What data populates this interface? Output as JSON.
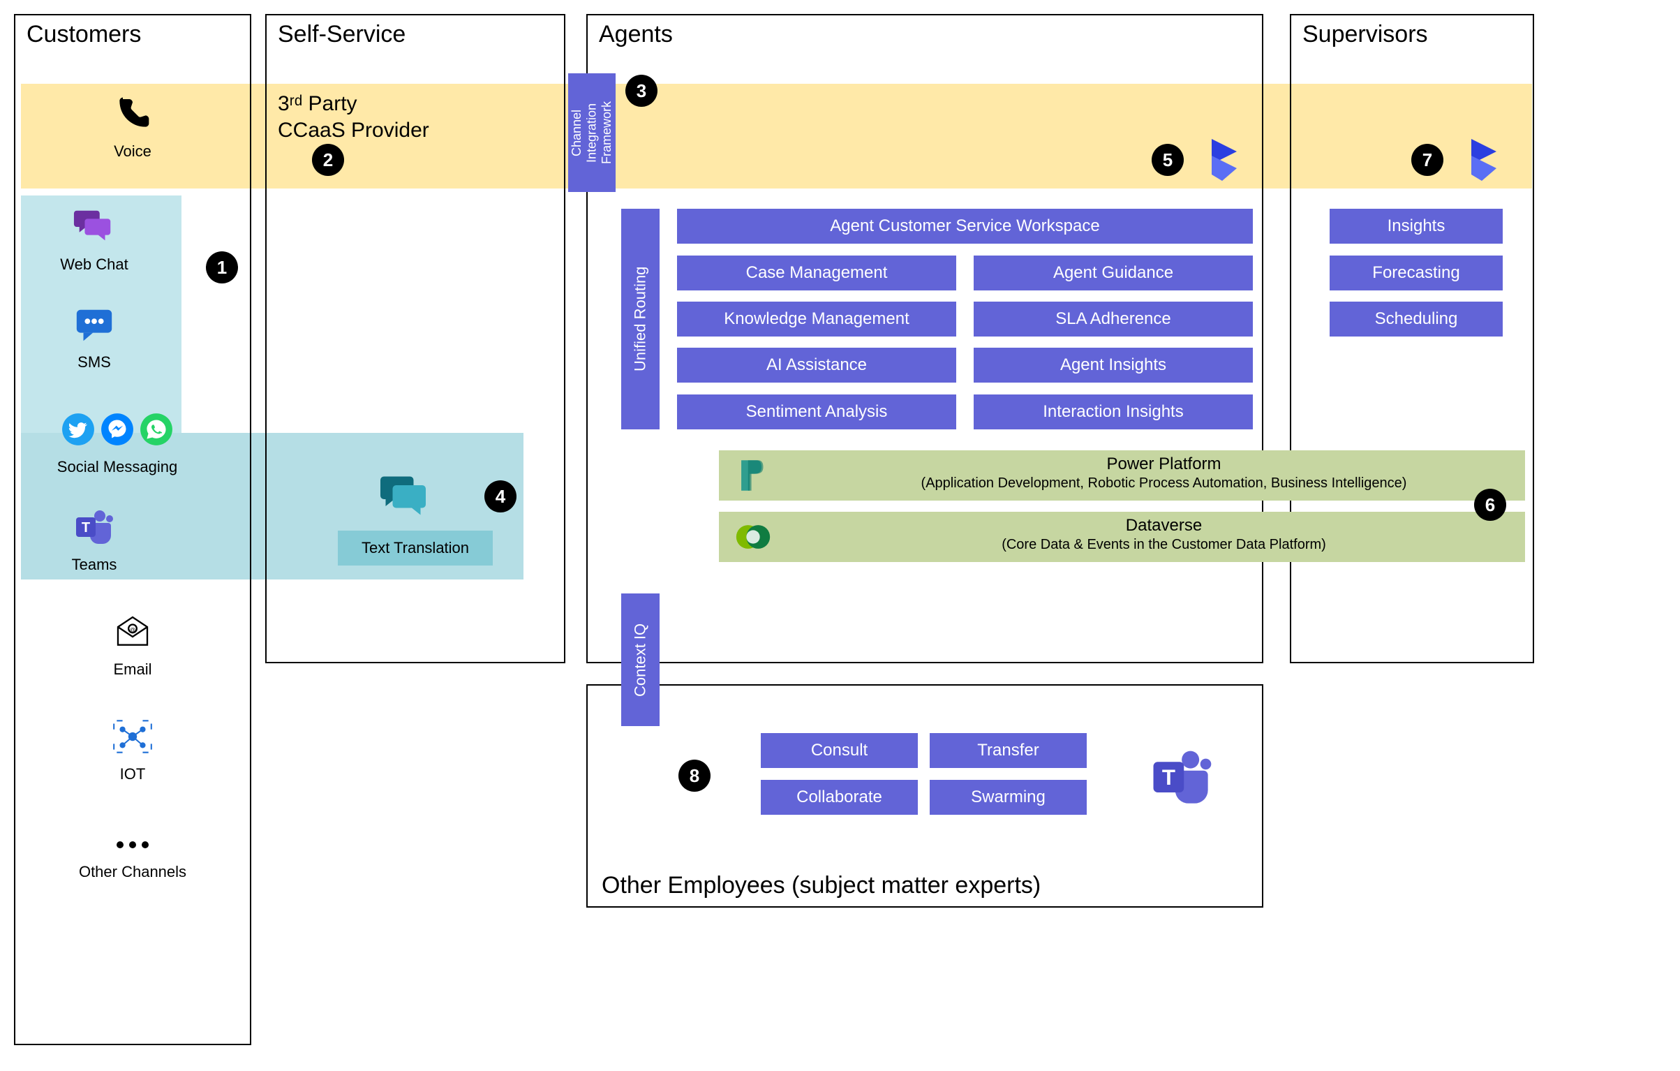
{
  "sections": {
    "customers": "Customers",
    "selfservice": "Self-Service",
    "agents": "Agents",
    "supervisors": "Supervisors",
    "other_employees": "Other Employees (subject matter experts)"
  },
  "ccaas": {
    "line1": "3ʳᵈ Party",
    "line2": "CCaaS Provider"
  },
  "cif": "Channel\nIntegration\nFramework",
  "unified_routing": "Unified Routing",
  "context_iq": "Context IQ",
  "agent_blocks": {
    "acsw": "Agent Customer Service Workspace",
    "case_mgmt": "Case Management",
    "agent_guidance": "Agent Guidance",
    "knowledge_mgmt": "Knowledge Management",
    "sla": "SLA Adherence",
    "ai_assist": "AI Assistance",
    "agent_insights": "Agent Insights",
    "sentiment": "Sentiment Analysis",
    "interaction_insights": "Interaction Insights"
  },
  "supervisor_blocks": {
    "insights": "Insights",
    "forecasting": "Forecasting",
    "scheduling": "Scheduling"
  },
  "other_emp_blocks": {
    "consult": "Consult",
    "transfer": "Transfer",
    "collaborate": "Collaborate",
    "swarming": "Swarming"
  },
  "platforms": {
    "pp_title": "Power Platform",
    "pp_sub": "(Application Development, Robotic Process Automation, Business Intelligence)",
    "dv_title": "Dataverse",
    "dv_sub": "(Core Data & Events in the Customer Data Platform)"
  },
  "text_translation": "Text Translation",
  "channels": {
    "voice": "Voice",
    "webchat": "Web Chat",
    "sms": "SMS",
    "social": "Social Messaging",
    "teams": "Teams",
    "email": "Email",
    "iot": "IOT",
    "other": "Other Channels"
  },
  "badges": {
    "b1": "1",
    "b2": "2",
    "b3": "3",
    "b4": "4",
    "b5": "5",
    "b6": "6",
    "b7": "7",
    "b8": "8"
  }
}
